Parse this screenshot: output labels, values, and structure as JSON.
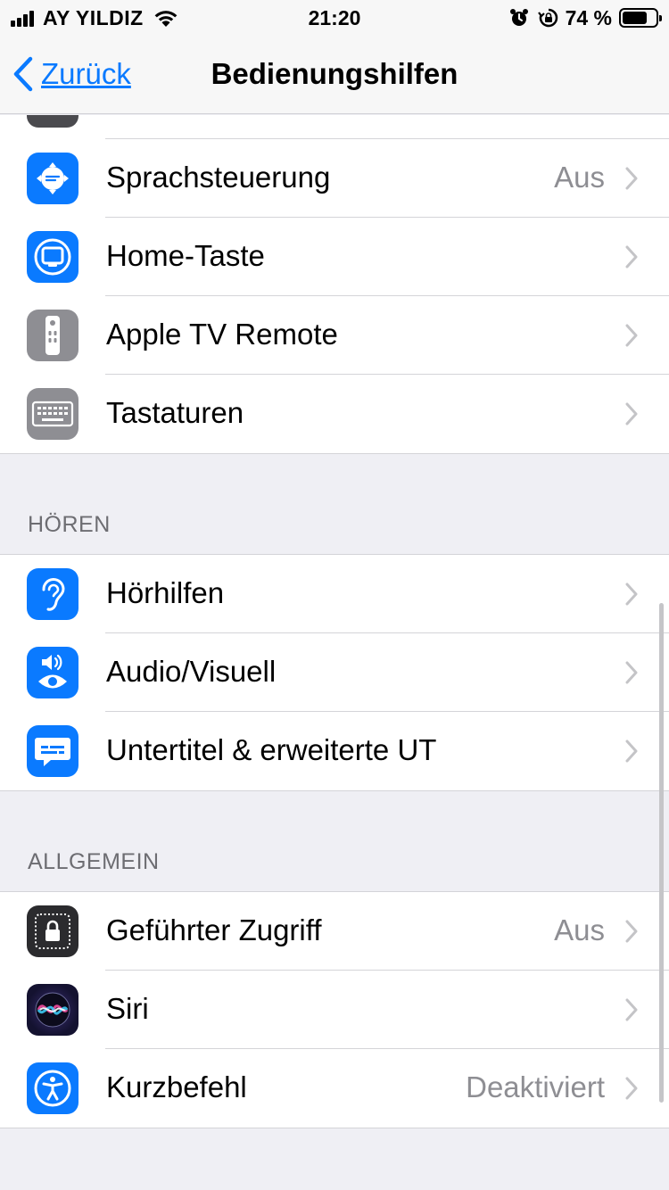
{
  "status_bar": {
    "carrier": "AY YILDIZ",
    "time": "21:20",
    "battery_percent": "74 %",
    "battery_level": 0.74,
    "icons": [
      "signal-icon",
      "wifi-icon",
      "alarm-icon",
      "orientation-lock-icon",
      "battery-icon"
    ]
  },
  "nav": {
    "back_label": "Zurück",
    "title": "Bedienungshilfen"
  },
  "rows_top": [
    {
      "label": "Sprachsteuerung",
      "value": "Aus",
      "icon": "voice-control-icon"
    },
    {
      "label": "Home-Taste",
      "value": "",
      "icon": "home-button-icon"
    },
    {
      "label": "Apple TV Remote",
      "value": "",
      "icon": "remote-icon"
    },
    {
      "label": "Tastaturen",
      "value": "",
      "icon": "keyboard-icon"
    }
  ],
  "sections": {
    "hoeren": {
      "header": "HÖREN",
      "rows": [
        {
          "label": "Hörhilfen",
          "value": "",
          "icon": "ear-icon"
        },
        {
          "label": "Audio/Visuell",
          "value": "",
          "icon": "audio-visual-icon"
        },
        {
          "label": "Untertitel & erweiterte UT",
          "value": "",
          "icon": "subtitles-icon"
        }
      ]
    },
    "allgemein": {
      "header": "ALLGEMEIN",
      "rows": [
        {
          "label": "Geführter Zugriff",
          "value": "Aus",
          "icon": "guided-access-icon"
        },
        {
          "label": "Siri",
          "value": "",
          "icon": "siri-icon"
        },
        {
          "label": "Kurzbefehl",
          "value": "Deaktiviert",
          "icon": "accessibility-icon"
        }
      ]
    }
  },
  "colors": {
    "accent": "#0a7aff",
    "background": "#efeff4",
    "secondary_text": "#8e8e93",
    "icon_gray": "#8e8e93"
  }
}
